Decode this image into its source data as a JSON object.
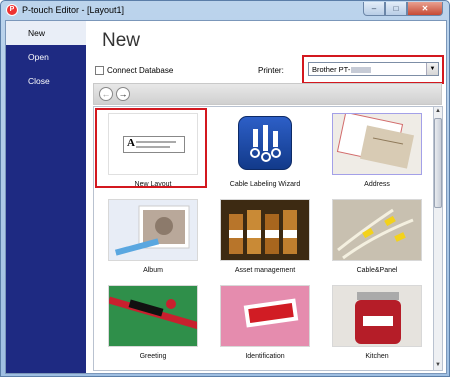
{
  "window": {
    "title": "P-touch Editor - [Layout1]",
    "controls": {
      "minimize": "–",
      "maximize": "□",
      "close": "✕"
    }
  },
  "sidebar": {
    "items": [
      {
        "label": "New"
      },
      {
        "label": "Open"
      },
      {
        "label": "Close"
      }
    ]
  },
  "main": {
    "heading": "New",
    "connect_database_label": "Connect Database",
    "connect_database_checked": false,
    "printer_label": "Printer:",
    "printer_value": "Brother PT-",
    "nav": {
      "back": "←",
      "forward": "→"
    }
  },
  "templates": [
    {
      "label": "New Layout"
    },
    {
      "label": "Cable Labeling Wizard"
    },
    {
      "label": "Address"
    },
    {
      "label": "Album"
    },
    {
      "label": "Asset management"
    },
    {
      "label": "Cable&Panel"
    },
    {
      "label": "Greeting"
    },
    {
      "label": "Identification"
    },
    {
      "label": "Kitchen"
    }
  ],
  "scrollbar": {
    "up": "▲",
    "down": "▼"
  },
  "colors": {
    "sidebar_bg": "#1e2a82",
    "highlight_red": "#d3181f"
  }
}
